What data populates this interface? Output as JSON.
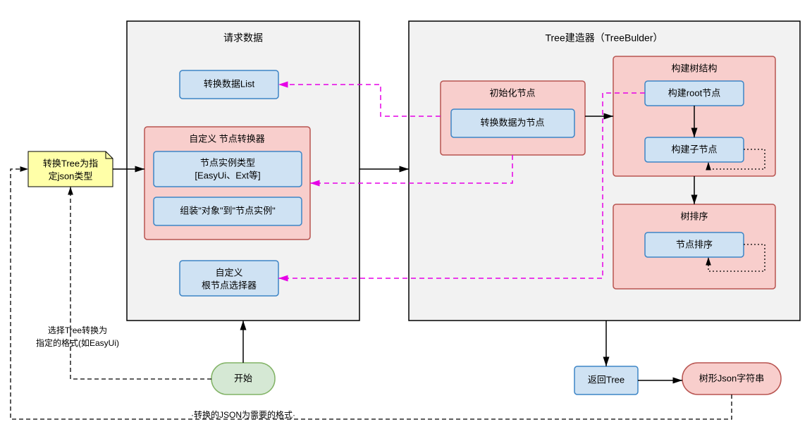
{
  "left_container_title": "请求数据",
  "right_container_title": "Tree建造器（TreeBulder）",
  "convert_list": "转换数据List",
  "custom_converter_title": "自定义 节点转换器",
  "node_instance_type_l1": "节点实例类型",
  "node_instance_type_l2": "[EasyUi、Ext等]",
  "assemble_object": "组装\"对象\"到\"节点实例\"",
  "custom_root_selector_l1": "自定义",
  "custom_root_selector_l2": "根节点选择器",
  "init_node_title": "初始化节点",
  "convert_to_node": "转换数据为节点",
  "build_tree_title": "构建树结构",
  "build_root": "构建root节点",
  "build_child": "构建子节点",
  "tree_sort_title": "树排序",
  "node_sort": "节点排序",
  "convert_tree_json_l1": "转换Tree为指",
  "convert_tree_json_l2": "定json类型",
  "start": "开始",
  "return_tree": "返回Tree",
  "tree_json_string": "树形Json字符串",
  "label_select_tree_l1": "选择Tree转换为",
  "label_select_tree_l2": "指定的格式(如EasyUi)",
  "label_json_format": "·转换的JSON为需要的格式·"
}
